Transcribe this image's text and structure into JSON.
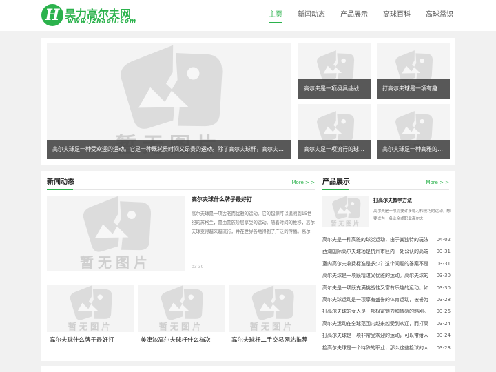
{
  "site": {
    "logo_mark": "H",
    "logo_name": "昊力高尔夫网",
    "logo_url": "www.jzhaoli.com"
  },
  "nav": {
    "items": [
      "主页",
      "新闻动态",
      "产品展示",
      "高球百科",
      "高球常识"
    ]
  },
  "placeholder": {
    "text": "暂无图片"
  },
  "banner": {
    "main_caption": "高尔夫球是一种受欢迎的运动。它是一种既耗费时间又昂贵的运动。除了高尔夫球杆，高尔夫球还需要很多装备。",
    "tiles": [
      "高尔夫是一项极具挑战性的运动",
      "打高尔夫球是一项有趣而富有挑战性的运动",
      "高尔夫是一项流行的球类运动",
      "高尔夫球是一种高雅的球类运动"
    ]
  },
  "news": {
    "title": "新闻动态",
    "more": "More > >",
    "lead": {
      "title": "高尔夫球什么牌子最好打",
      "desc": "高尔夫球是一项古老而优雅的运动。它的起源可以追溯到15世纪的苏格兰，是由贵族阶层享受的运动。随着时间的推移，高尔夫球变得越来越流行，并在世界各地得到了广泛的传播。高尔",
      "date": "03-30"
    },
    "thumbs": [
      "高尔夫球什么牌子最好打",
      "美津浓高尔夫球杆什么档次",
      "高尔夫球杆二手交易网站推荐"
    ]
  },
  "products": {
    "title": "产品展示",
    "more": "More > >",
    "featured": {
      "title": "打高尔夫教学方法",
      "desc": "高尔夫是一项需要许多练习和技巧的运动，想要成为一名业余或职业高尔夫"
    },
    "list": [
      {
        "title": "高尔夫是一种高雅的球类运动，由于其独特的玩法",
        "date": "04-02"
      },
      {
        "title": "西湖国际高尔夫球场是杭州市区内一处公认的高端",
        "date": "03-31"
      },
      {
        "title": "室内高尔夫收费标准是多少？这个问题的答案不是",
        "date": "03-31"
      },
      {
        "title": "高尔夫球是一项既精湛又优雅的运动。高尔夫球的",
        "date": "03-30"
      },
      {
        "title": "高尔夫是一项既充满挑战性又富有乐趣的运动。如",
        "date": "03-30"
      },
      {
        "title": "高尔夫球运动是一项享有盛誉的体育运动，被誉为",
        "date": "03-28"
      },
      {
        "title": "打高尔夫球的女人是一部极富魅力和情感的韩剧。",
        "date": "03-26"
      },
      {
        "title": "高尔夫运动在全球范围内越来越受到欢迎，而打高",
        "date": "03-24"
      },
      {
        "title": "打高尔夫球是一项非常受欢迎的运动，可以带给人",
        "date": "03-24"
      },
      {
        "title": "捡高尔夫球是一个特殊的职业，那么这些捡球的人",
        "date": "03-23"
      }
    ]
  },
  "colors": {
    "accent": "#2bb24c",
    "caption_bg": "#3c3c3c",
    "placeholder_bg": "#f4f4f4"
  }
}
